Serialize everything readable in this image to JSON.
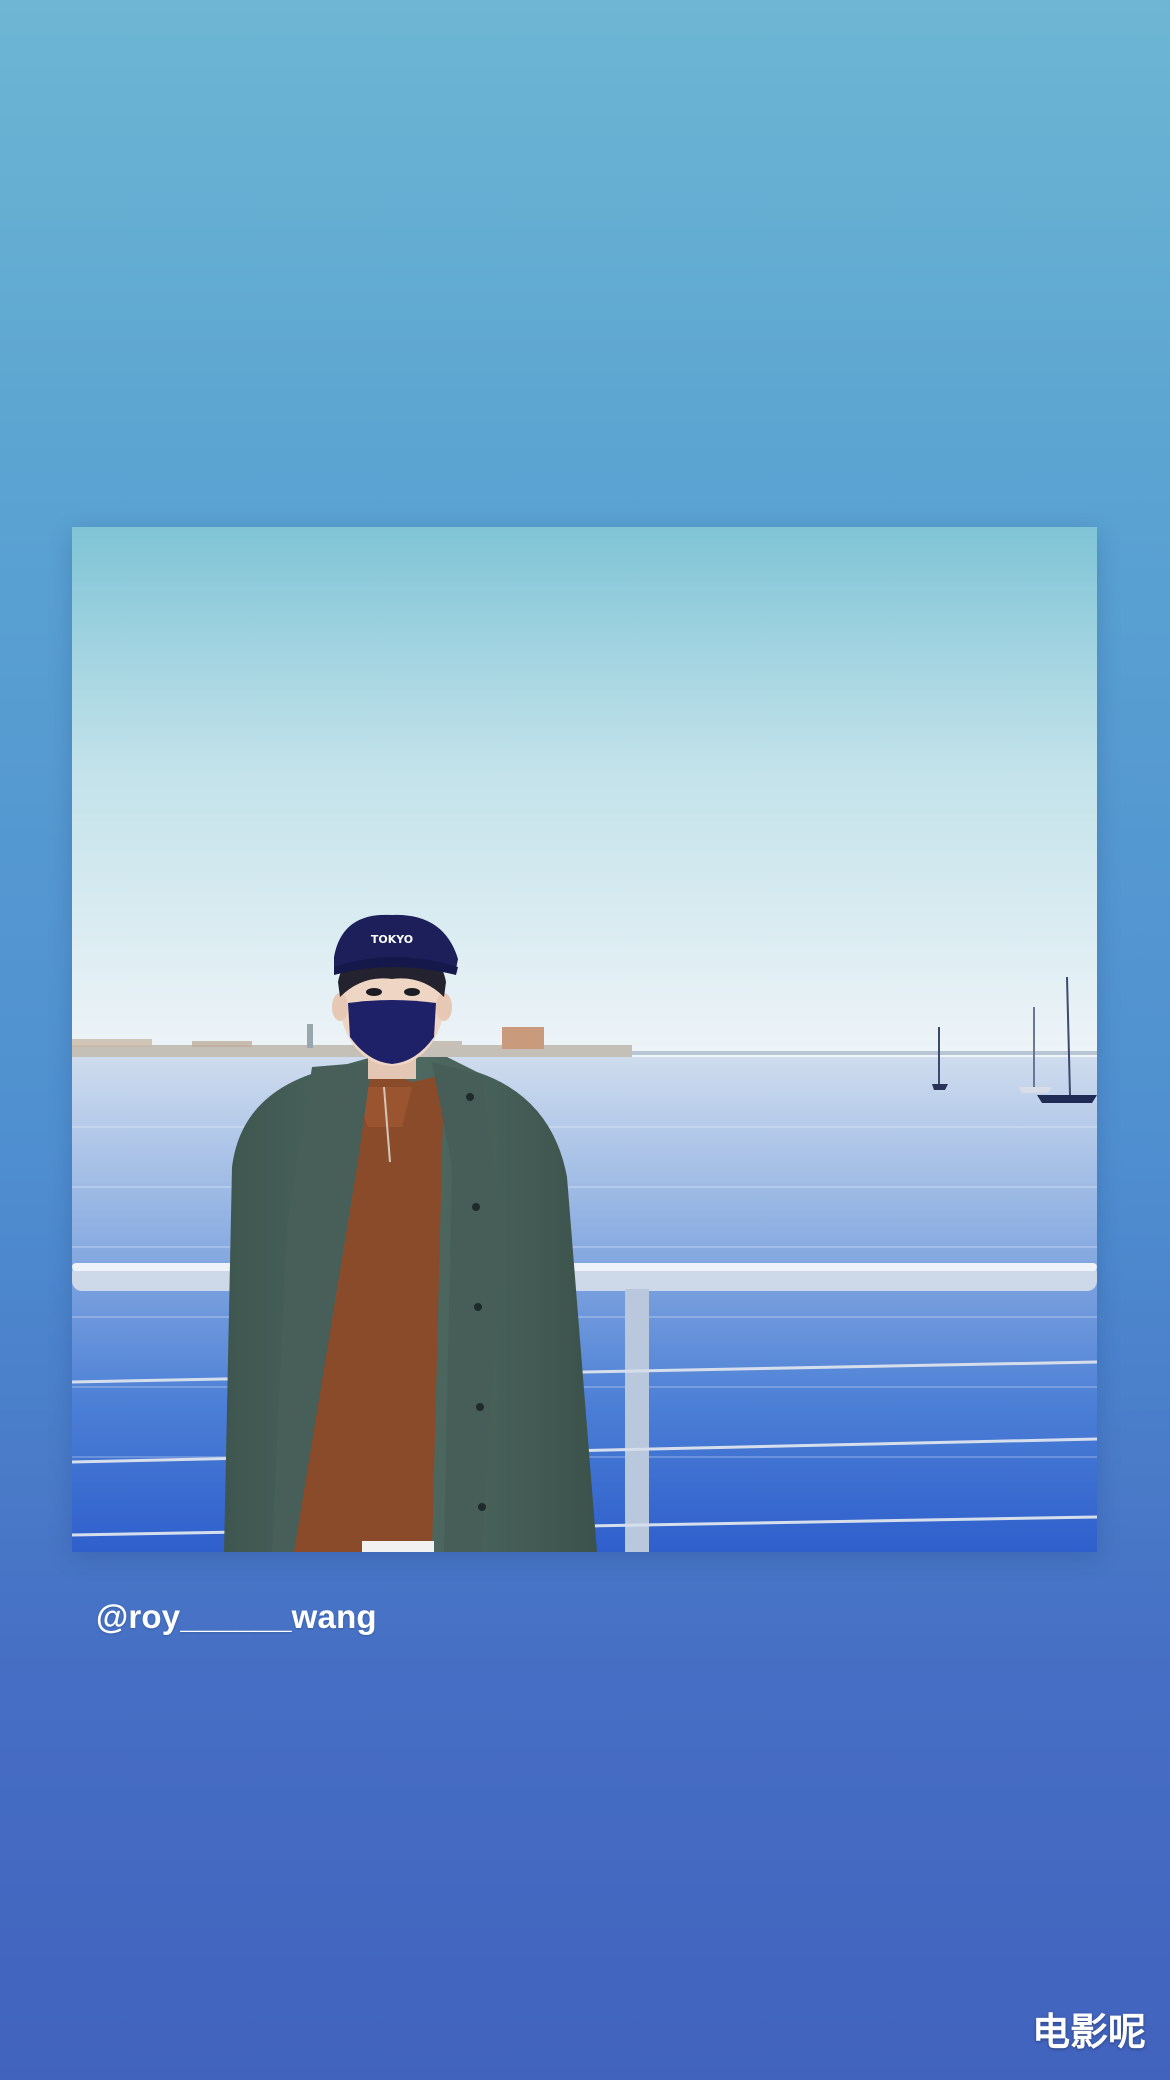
{
  "story": {
    "mention": "@roy______wang",
    "watermark": "电影呢"
  },
  "photo": {
    "cap_text": "TOKYO"
  },
  "colors": {
    "background_top": "#6eb6d3",
    "background_bottom": "#4163be",
    "mention_text": "#ffffff"
  }
}
